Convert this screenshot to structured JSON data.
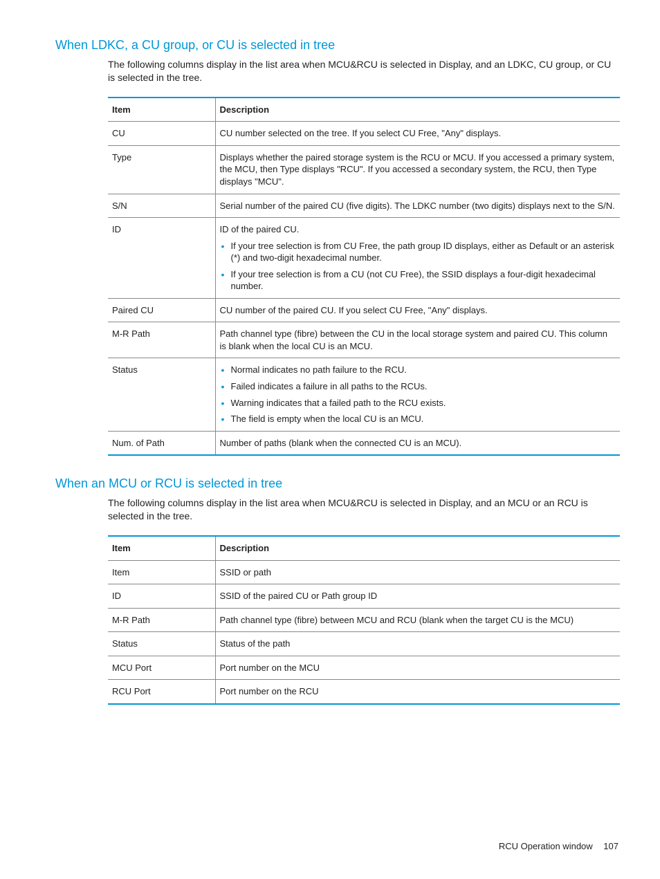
{
  "section1": {
    "heading": "When LDKC, a CU group, or CU is selected in tree",
    "intro": "The following columns display in the list area when MCU&RCU is selected in Display, and an LDKC, CU group, or CU is selected in the tree.",
    "headers": {
      "item": "Item",
      "desc": "Description"
    },
    "rows": [
      {
        "item": "CU",
        "desc": [
          {
            "type": "text",
            "value": "CU number selected on the tree. If you select CU Free, \"Any\" displays."
          }
        ]
      },
      {
        "item": "Type",
        "desc": [
          {
            "type": "text",
            "value": "Displays whether the paired storage system is the RCU or MCU. If you accessed a primary system, the MCU, then Type displays \"RCU\". If you accessed a secondary system, the RCU, then Type displays \"MCU\"."
          }
        ]
      },
      {
        "item": "S/N",
        "desc": [
          {
            "type": "text",
            "value": "Serial number of the paired CU (five digits). The LDKC number (two digits) displays next to the S/N."
          }
        ]
      },
      {
        "item": "ID",
        "desc": [
          {
            "type": "text",
            "value": "ID of the paired CU."
          },
          {
            "type": "list",
            "items": [
              "If your tree selection is from CU Free, the path group ID displays, either as Default or an asterisk (*) and two-digit hexadecimal number.",
              "If your tree selection is from a CU (not CU Free), the SSID displays a four-digit hexadecimal number."
            ]
          }
        ]
      },
      {
        "item": "Paired CU",
        "desc": [
          {
            "type": "text",
            "value": "CU number of the paired CU. If you select CU Free, \"Any\" displays."
          }
        ]
      },
      {
        "item": "M-R Path",
        "desc": [
          {
            "type": "text",
            "value": "Path channel type (fibre) between the CU in the local storage system and paired CU. This column is blank when the local CU is an MCU."
          }
        ]
      },
      {
        "item": "Status",
        "desc": [
          {
            "type": "list",
            "items": [
              "Normal indicates no path failure to the RCU.",
              "Failed indicates a failure in all paths to the RCUs.",
              "Warning indicates that a failed path to the RCU exists.",
              "The field is empty when the local CU is an MCU."
            ]
          }
        ]
      },
      {
        "item": "Num. of Path",
        "desc": [
          {
            "type": "text",
            "value": "Number of paths (blank when the connected CU is an MCU)."
          }
        ]
      }
    ]
  },
  "section2": {
    "heading": "When an MCU or RCU is selected in tree",
    "intro": "The following columns display in the list area when MCU&RCU is selected in Display, and an MCU or an RCU is selected in the tree.",
    "headers": {
      "item": "Item",
      "desc": "Description"
    },
    "rows": [
      {
        "item": "Item",
        "desc": [
          {
            "type": "text",
            "value": "SSID or path"
          }
        ]
      },
      {
        "item": "ID",
        "desc": [
          {
            "type": "text",
            "value": "SSID of the paired CU or Path group ID"
          }
        ]
      },
      {
        "item": "M-R Path",
        "desc": [
          {
            "type": "text",
            "value": "Path channel type (fibre) between MCU and RCU (blank when the target CU is the MCU)"
          }
        ]
      },
      {
        "item": "Status",
        "desc": [
          {
            "type": "text",
            "value": "Status of the path"
          }
        ]
      },
      {
        "item": "MCU Port",
        "desc": [
          {
            "type": "text",
            "value": "Port number on the MCU"
          }
        ]
      },
      {
        "item": "RCU Port",
        "desc": [
          {
            "type": "text",
            "value": "Port number on the RCU"
          }
        ]
      }
    ]
  },
  "footer": {
    "title": "RCU Operation window",
    "page": "107"
  }
}
